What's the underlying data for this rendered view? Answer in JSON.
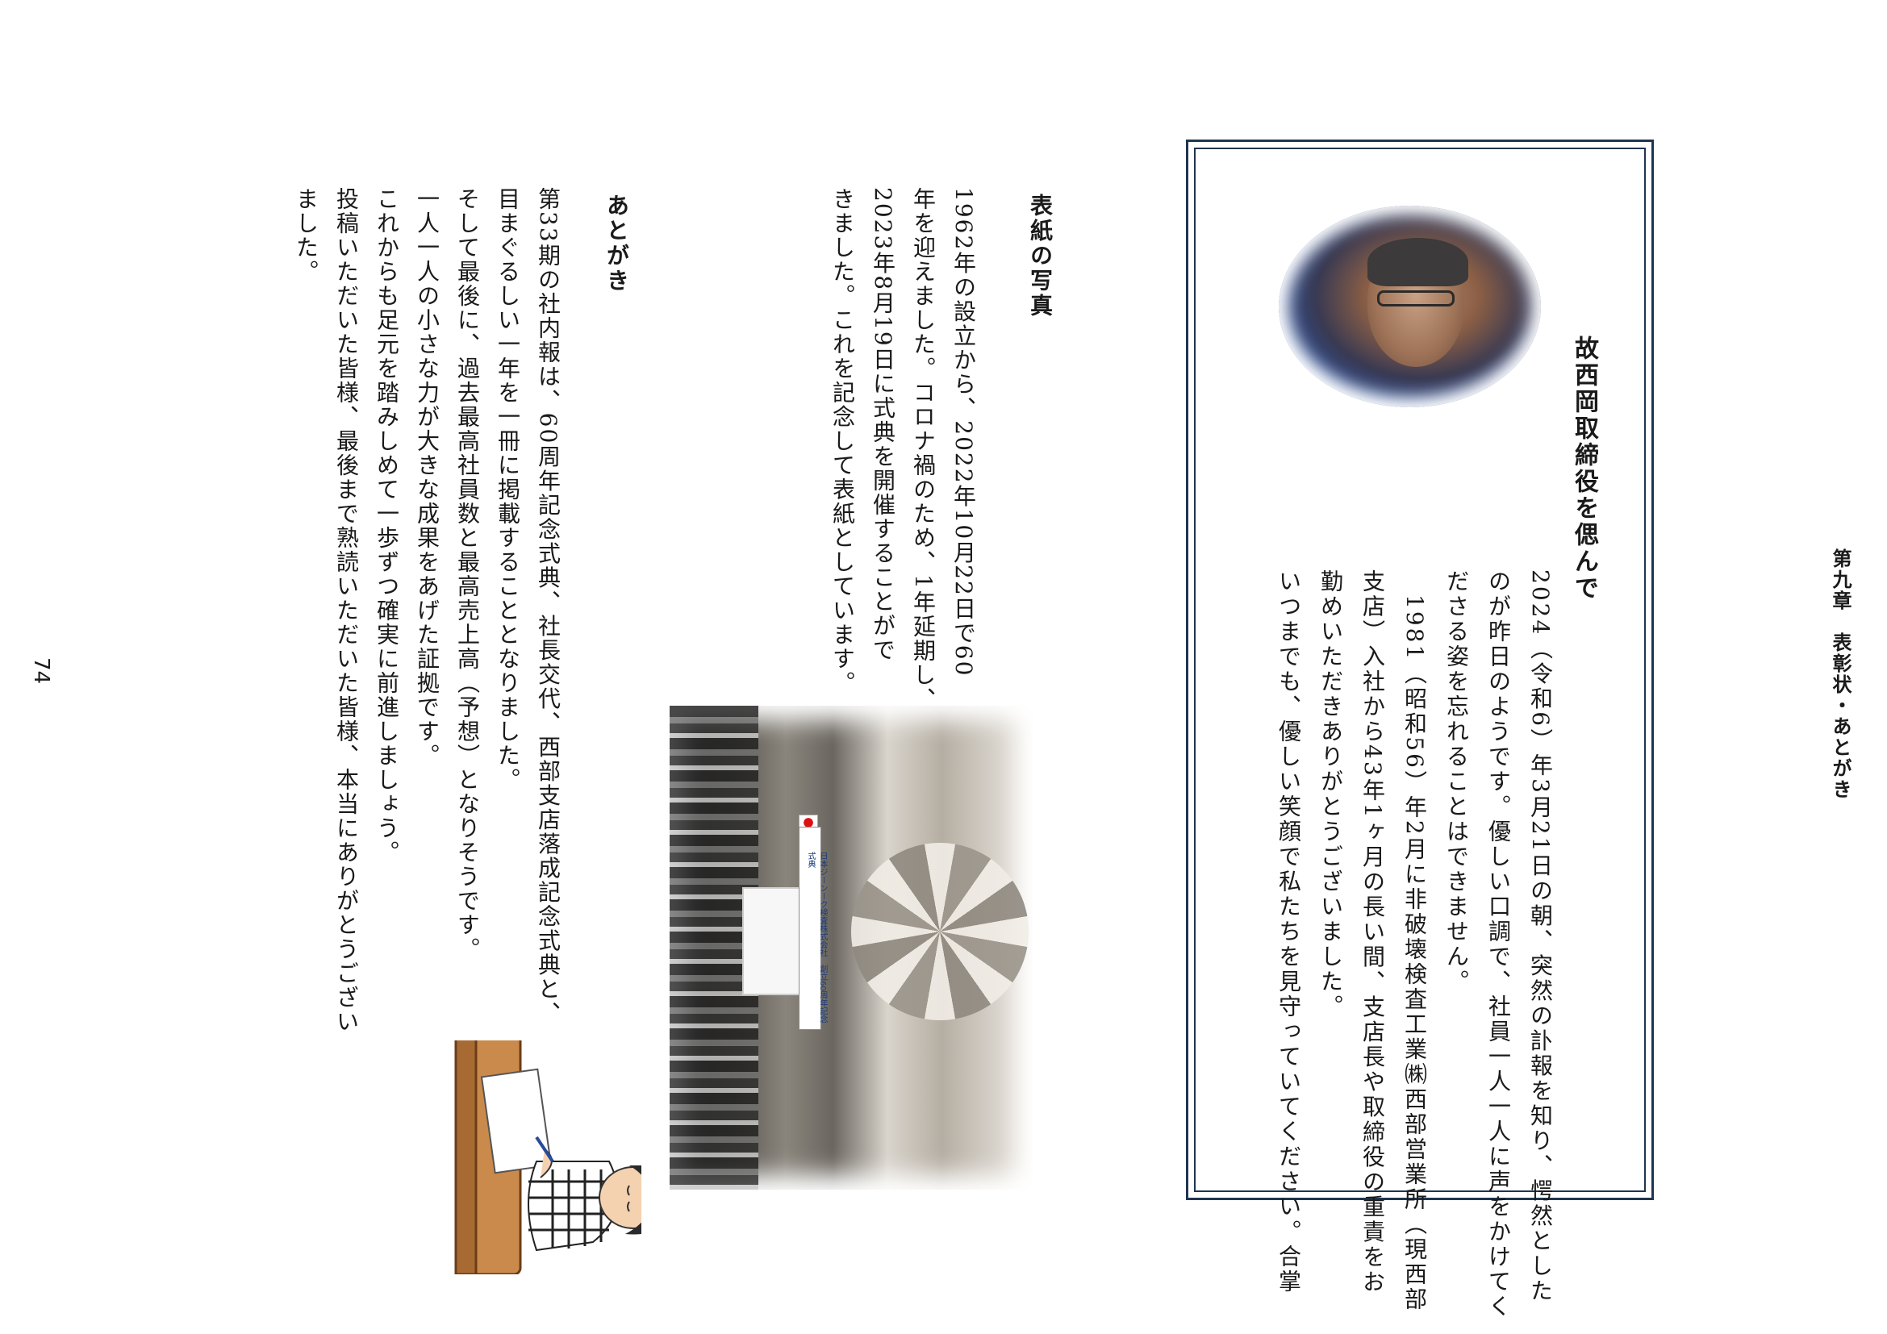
{
  "header": {
    "chapter": "第九章　表彰状・あとがき"
  },
  "memorial": {
    "title": "故西岡取締役を偲んで",
    "paragraphs": [
      "2024（令和6）年3月21日の朝、突然の訃報を知り、愕然とした",
      "のが昨日のようです。優しい口調で、社員一人一人に声をかけてく",
      "ださる姿を忘れることはできません。",
      "　1981（昭和56）年2月に非破壊検査工業㈱西部営業所（現西部",
      "支店）入社から43年1ヶ月の長い間、支店長や取締役の重責をお",
      "勤めいただきありがとうございました。",
      "いつまでも、優しい笑顔で私たちを見守っていてください。合掌"
    ],
    "portrait_icon": "portrait-photo"
  },
  "cover_photo": {
    "title": "表紙の写真",
    "paragraphs": [
      "1962年の設立から、2022年10月22日で60",
      "年を迎えました。コロナ禍のため、1年延期し、",
      "2023年8月19日に式典を開催することがで",
      "きました。これを記念して表紙としています。"
    ],
    "photo_banner": "日本ジーンーク検査株式会社　創立60周年記念式典"
  },
  "afterword": {
    "title": "あとがき",
    "paragraphs": [
      "第33期の社内報は、60周年記念式典、社長交代、西部支店落成記念式典と、",
      "目まぐるしい一年を一冊に掲載することとなりました。",
      "そして最後に、過去最高社員数と最高売上高（予想）となりそうです。",
      "一人一人の小さな力が大きな成果をあげた証拠です。",
      "これからも足元を踏みしめて一歩ずつ確実に前進しましょう。",
      "投稿いただいた皆様、最後まで熟読いただいた皆様、本当にありがとうござい",
      "ました。"
    ]
  },
  "page": {
    "number": "74"
  },
  "colors": {
    "frame": "#1f3550",
    "text": "#1a1a1a"
  }
}
